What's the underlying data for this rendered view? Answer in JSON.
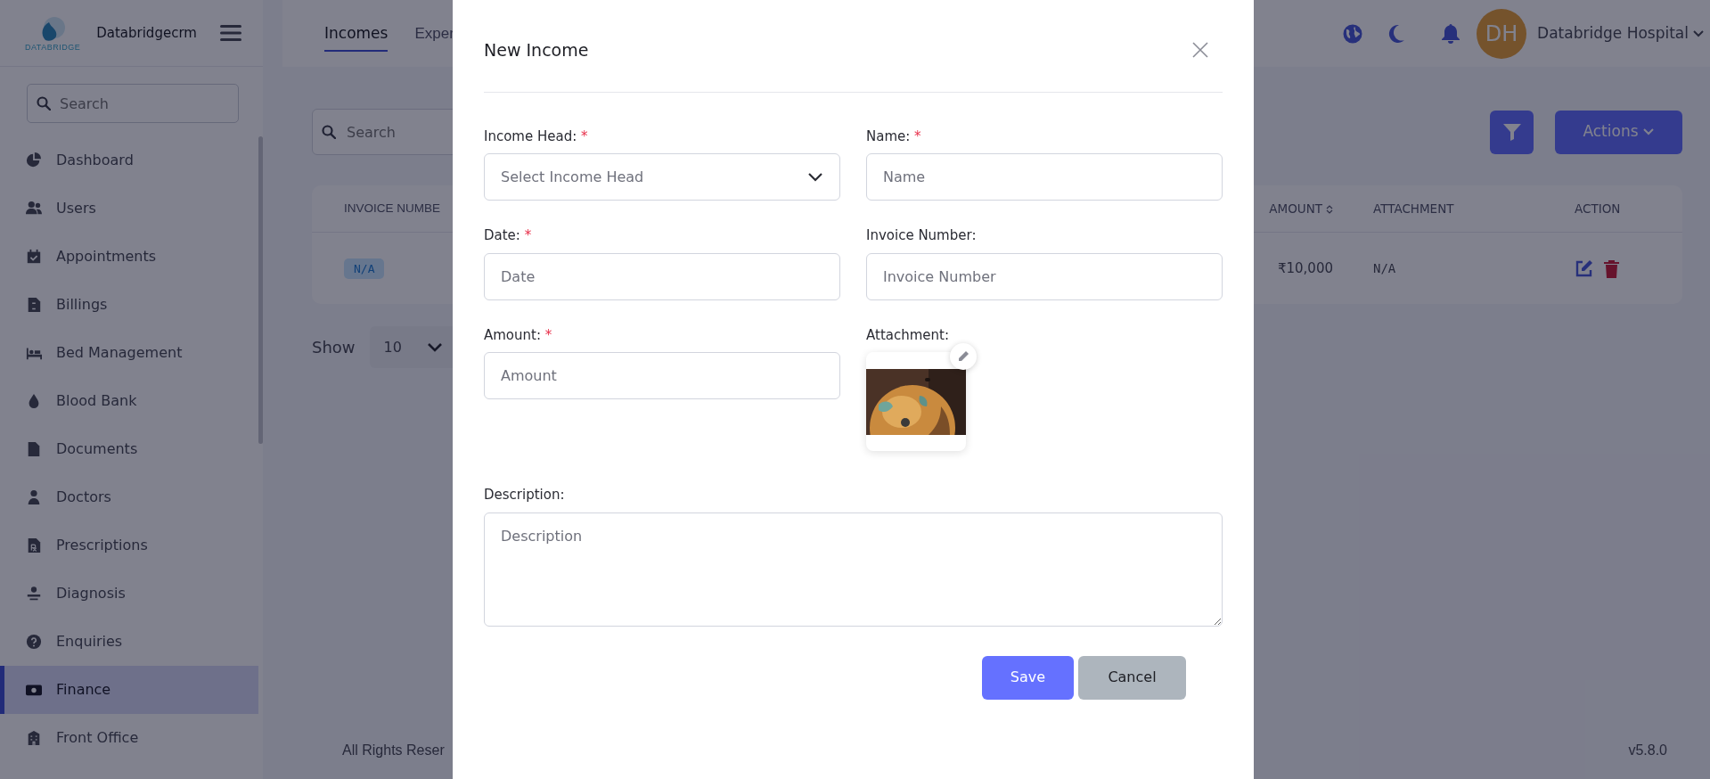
{
  "sidebar": {
    "logo_text": "DATABRIDGE",
    "brand": "Databridgecrm",
    "search": {
      "placeholder": "Search"
    },
    "items": [
      {
        "label": "Dashboard",
        "selected": false
      },
      {
        "label": "Users",
        "selected": false
      },
      {
        "label": "Appointments",
        "selected": false
      },
      {
        "label": "Billings",
        "selected": false
      },
      {
        "label": "Bed Management",
        "selected": false
      },
      {
        "label": "Blood Bank",
        "selected": false
      },
      {
        "label": "Documents",
        "selected": false
      },
      {
        "label": "Doctors",
        "selected": false
      },
      {
        "label": "Prescriptions",
        "selected": false
      },
      {
        "label": "Diagnosis",
        "selected": false
      },
      {
        "label": "Enquiries",
        "selected": false
      },
      {
        "label": "Finance",
        "selected": true
      },
      {
        "label": "Front Office",
        "selected": false
      }
    ]
  },
  "header": {
    "tabs": [
      {
        "label": "Incomes",
        "selected": true
      },
      {
        "label": "Exper",
        "selected": false
      }
    ],
    "avatar": "DH",
    "user": "Databridge Hospital"
  },
  "toolbar": {
    "search": {
      "placeholder": "Search"
    },
    "actions": "Actions"
  },
  "table": {
    "columns": [
      "INVOICE NUMBE",
      "AMOUNT",
      "ATTACHMENT",
      "ACTION"
    ],
    "rows": [
      {
        "invoice": "N/A",
        "amount": "₹10,000",
        "attachment": "N/A"
      }
    ]
  },
  "pagination": {
    "label": "Show",
    "per_page": "10"
  },
  "footer": {
    "copyright": "All Rights Reser",
    "version": "v5.8.0"
  },
  "modal": {
    "title": "New Income",
    "fields": [
      {
        "kind": "select",
        "label": "Income Head:",
        "required_mark": "*",
        "placeholder": "Select Income Head"
      },
      {
        "kind": "text",
        "label": "Name:",
        "required_mark": "*",
        "placeholder": "Name"
      },
      {
        "kind": "text",
        "label": "Date:",
        "required_mark": "*",
        "placeholder": "Date"
      },
      {
        "kind": "text",
        "label": "Invoice Number:",
        "placeholder": "Invoice Number"
      },
      {
        "kind": "text",
        "label": "Amount:",
        "required_mark": "*",
        "placeholder": "Amount"
      },
      {
        "label": "Attachment:"
      }
    ],
    "description": {
      "label": "Description:",
      "placeholder": "Description"
    },
    "buttons": [
      {
        "kind": "primary",
        "label": "Save"
      },
      {
        "kind": "secondary",
        "label": "Cancel"
      }
    ]
  }
}
